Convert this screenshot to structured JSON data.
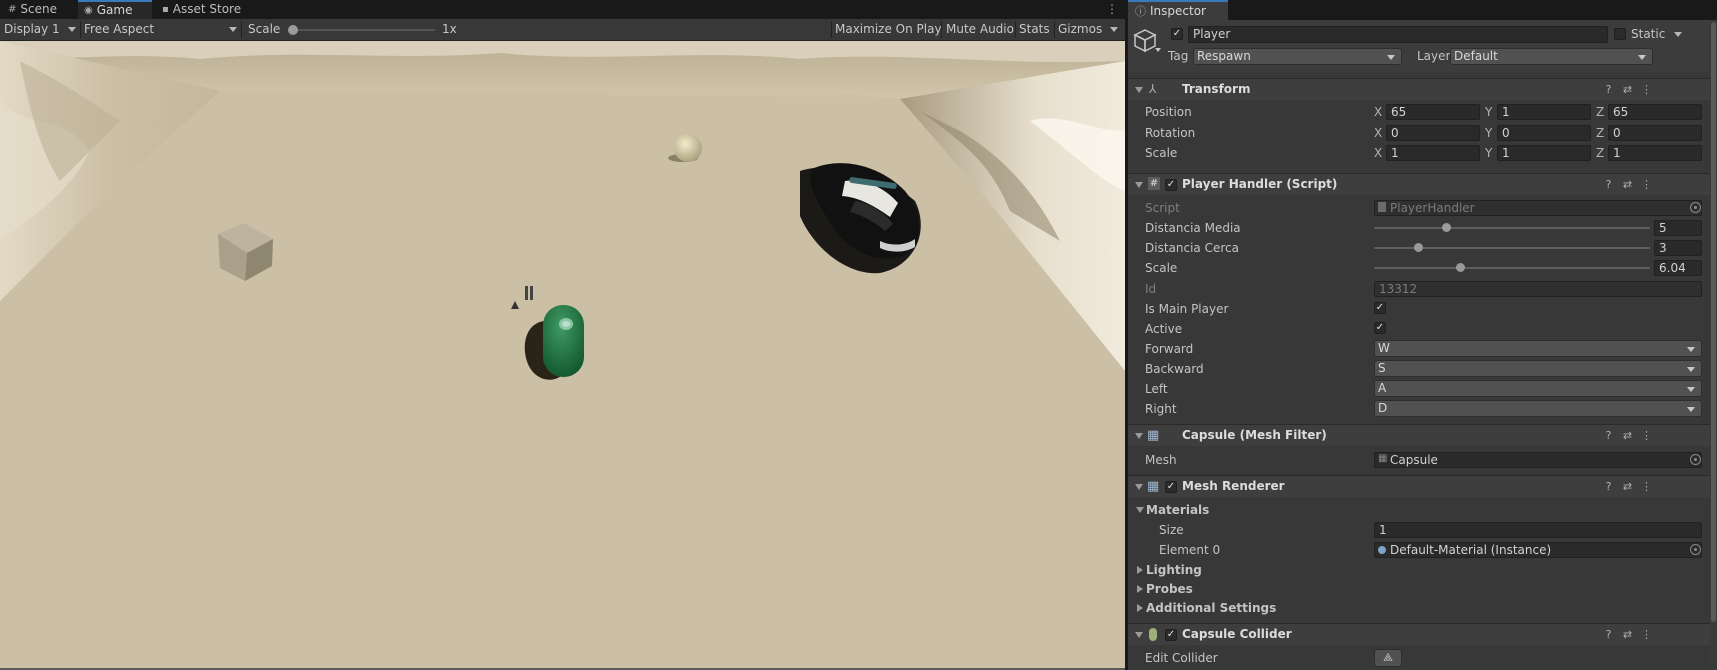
{
  "tabs": {
    "scene": "Scene",
    "game": "Game",
    "asset_store": "Asset Store"
  },
  "game_toolbar": {
    "display": "Display 1",
    "aspect": "Free Aspect",
    "scale_label": "Scale",
    "scale_value": "1x",
    "scale_slider_fraction": 0,
    "maximize": "Maximize On Play",
    "mute": "Mute Audio",
    "stats": "Stats",
    "gizmos": "Gizmos"
  },
  "inspector": {
    "tab": "Inspector",
    "object_name": "Player",
    "active": true,
    "static_label": "Static",
    "tag_label": "Tag",
    "tag_value": "Respawn",
    "layer_label": "Layer",
    "layer_value": "Default",
    "transform": {
      "title": "Transform",
      "position_label": "Position",
      "rotation_label": "Rotation",
      "scale_label": "Scale",
      "axes": {
        "x": "X",
        "y": "Y",
        "z": "Z"
      },
      "position": {
        "x": "65",
        "y": "1",
        "z": "65"
      },
      "rotation": {
        "x": "0",
        "y": "0",
        "z": "0"
      },
      "scale": {
        "x": "1",
        "y": "1",
        "z": "1"
      }
    },
    "player_handler": {
      "title": "Player Handler (Script)",
      "script_label": "Script",
      "script_value": "PlayerHandler",
      "distancia_media_label": "Distancia Media",
      "distancia_media_value": "5",
      "distancia_media_fraction": 0.26,
      "distancia_cerca_label": "Distancia Cerca",
      "distancia_cerca_value": "3",
      "distancia_cerca_fraction": 0.16,
      "scale_label": "Scale",
      "scale_value": "6.04",
      "scale_fraction": 0.31,
      "id_label": "Id",
      "id_value": "13312",
      "is_main_player_label": "Is Main Player",
      "is_main_player": true,
      "active_label": "Active",
      "active": true,
      "forward_label": "Forward",
      "forward_value": "W",
      "backward_label": "Backward",
      "backward_value": "S",
      "left_label": "Left",
      "left_value": "A",
      "right_label": "Right",
      "right_value": "D"
    },
    "mesh_filter": {
      "title": "Capsule (Mesh Filter)",
      "mesh_label": "Mesh",
      "mesh_value": "Capsule"
    },
    "mesh_renderer": {
      "title": "Mesh Renderer",
      "materials_label": "Materials",
      "size_label": "Size",
      "size_value": "1",
      "element0_label": "Element 0",
      "element0_value": "Default-Material (Instance)",
      "lighting_label": "Lighting",
      "probes_label": "Probes",
      "additional_label": "Additional Settings"
    },
    "capsule_collider": {
      "title": "Capsule Collider",
      "edit_collider_label": "Edit Collider"
    }
  },
  "colors": {
    "accent": "#3a79bb",
    "ground": "#cbbfa6",
    "capsule": "#2b7d4a"
  }
}
